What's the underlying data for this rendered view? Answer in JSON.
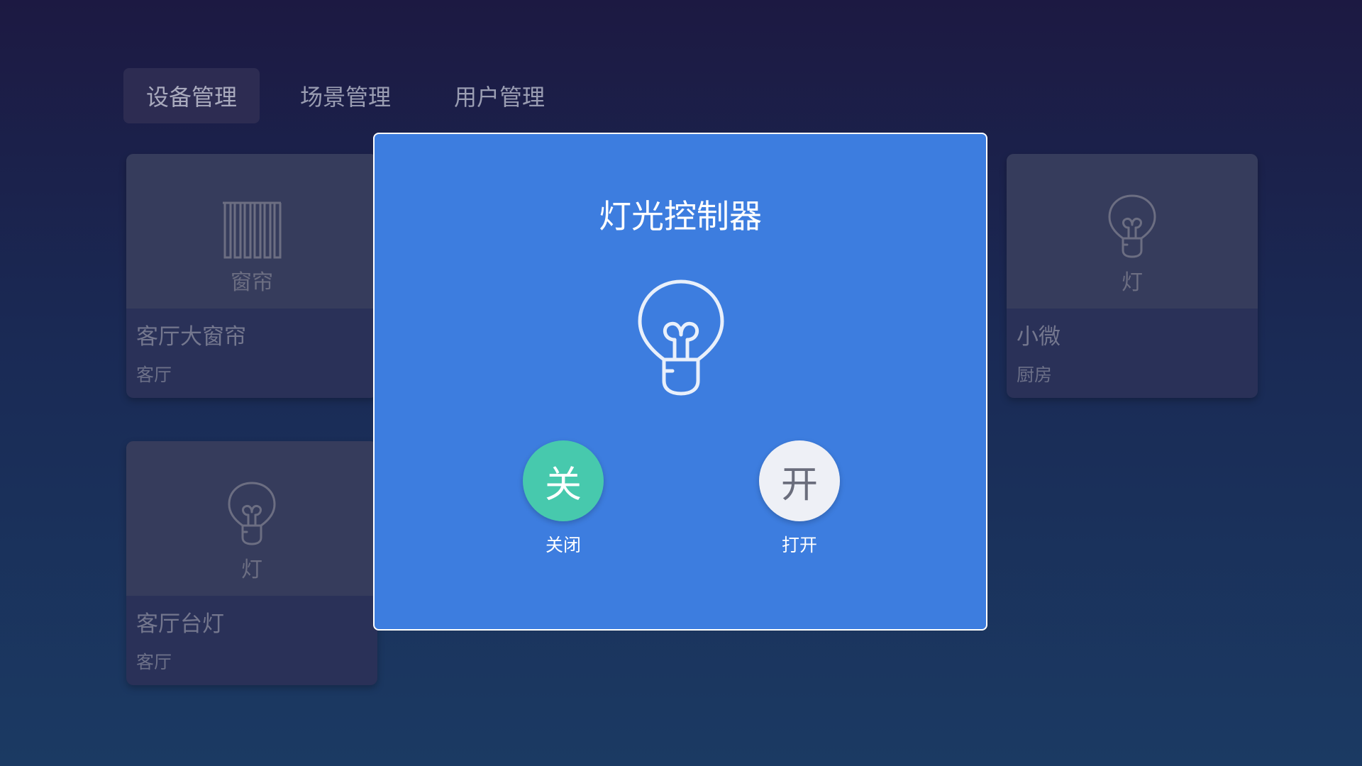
{
  "tabs": [
    {
      "label": "设备管理",
      "active": true
    },
    {
      "label": "场景管理",
      "active": false
    },
    {
      "label": "用户管理",
      "active": false
    }
  ],
  "devices": [
    {
      "type": "窗帘",
      "icon": "curtain-icon",
      "name": "客厅大窗帘",
      "room": "客厅"
    },
    {
      "type": "灯",
      "icon": "bulb-icon",
      "name": "小微",
      "room": "厨房"
    },
    {
      "type": "灯",
      "icon": "bulb-icon",
      "name": "客厅台灯",
      "room": "客厅"
    }
  ],
  "modal": {
    "title": "灯光控制器",
    "icon": "bulb-icon",
    "off_button": {
      "glyph": "关",
      "label": "关闭",
      "color": "#47c9ad"
    },
    "on_button": {
      "glyph": "开",
      "label": "打开",
      "color": "#eef0f6"
    }
  },
  "colors": {
    "modal_bg": "#3d7ddf",
    "background_top": "#1c1942",
    "background_bottom": "#1b3a63"
  }
}
